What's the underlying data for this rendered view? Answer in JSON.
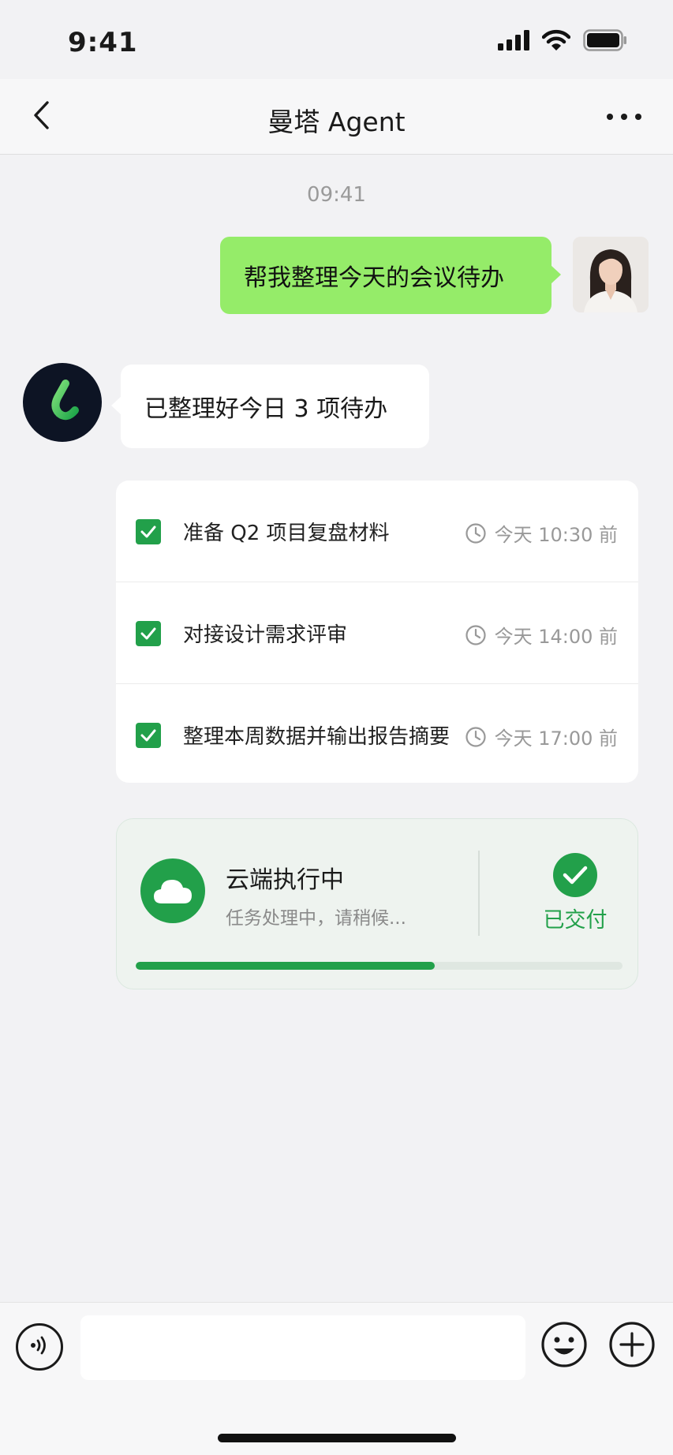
{
  "status_bar": {
    "time": "9:41",
    "icons": [
      "signal-icon",
      "wifi-icon",
      "battery-icon"
    ]
  },
  "nav": {
    "title": "曼塔 Agent",
    "back_icon": "chevron-left-icon",
    "more_icon": "more-dots-icon"
  },
  "chat": {
    "timestamp": "09:41",
    "user_message": "帮我整理今天的会议待办",
    "agent_message": "已整理好今日 3 项待办"
  },
  "todos": [
    {
      "text": "准备 Q2 项目复盘材料",
      "due": "今天 10:30 前",
      "checked": true
    },
    {
      "text": "对接设计需求评审",
      "due": "今天 14:00 前",
      "checked": true
    },
    {
      "text": "整理本周数据并输出报告摘要",
      "due": "今天 17:00 前",
      "checked": true
    }
  ],
  "task": {
    "title": "云端执行中",
    "subtitle": "任务处理中，请稍候...",
    "status_label": "已交付",
    "progress": 0.615
  },
  "input": {
    "placeholder": ""
  },
  "colors": {
    "accent_green": "#22a04a",
    "user_bubble": "#95ec69",
    "background": "#f2f2f4"
  }
}
